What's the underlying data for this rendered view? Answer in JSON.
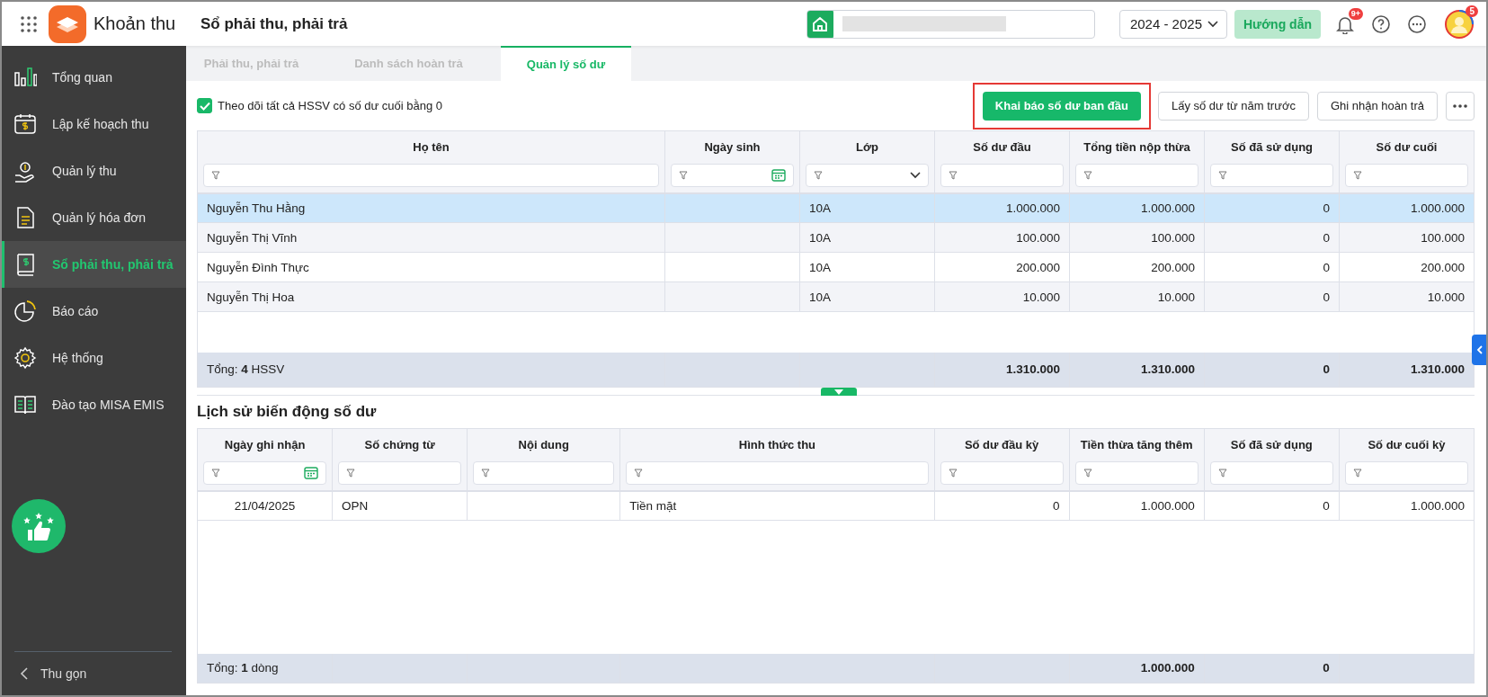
{
  "app": {
    "title": "Khoản thu",
    "page_title": "Sổ phải thu, phải trả"
  },
  "topbar": {
    "year": "2024 - 2025",
    "guide_button": "Hướng dẫn",
    "notification_badge": "9+",
    "avatar_badge": "5"
  },
  "sidebar": {
    "items": [
      {
        "label": "Tổng quan",
        "selected": false
      },
      {
        "label": "Lập kế hoạch thu",
        "selected": false
      },
      {
        "label": "Quản lý thu",
        "selected": false
      },
      {
        "label": "Quản lý hóa đơn",
        "selected": false
      },
      {
        "label": "Sổ phải thu, phải trả",
        "selected": true
      },
      {
        "label": "Báo cáo",
        "selected": false
      },
      {
        "label": "Hệ thống",
        "selected": false
      },
      {
        "label": "Đào tạo MISA EMIS",
        "selected": false
      }
    ],
    "collapse_label": "Thu gọn"
  },
  "tabs": [
    {
      "label": "Phải thu, phải trả",
      "selected": false
    },
    {
      "label": "Danh sách hoàn trả",
      "selected": false
    },
    {
      "label": "Quản lý số dư",
      "selected": true
    }
  ],
  "toolbar": {
    "checkbox": {
      "label": "Theo dõi tất cả HSSV có số dư cuối bằng 0",
      "checked": true
    },
    "buttons": [
      {
        "label": "Khai báo số dư ban đầu",
        "kind": "primary",
        "highlighted": true
      },
      {
        "label": "Lấy số dư từ năm trước",
        "kind": "outline",
        "highlighted": false
      },
      {
        "label": "Ghi nhận hoàn trả",
        "kind": "outline",
        "highlighted": false
      },
      {
        "kind": "more",
        "highlighted": false
      }
    ]
  },
  "balance_table": {
    "columns": [
      {
        "label": "Họ tên",
        "kind": "text"
      },
      {
        "label": "Ngày sinh",
        "kind": "date"
      },
      {
        "label": "Lớp",
        "kind": "select"
      },
      {
        "label": "Số dư đầu",
        "kind": "text",
        "total": "1.310.000"
      },
      {
        "label": "Tổng tiền nộp thừa",
        "kind": "text",
        "total": "1.310.000"
      },
      {
        "label": "Số đã sử dụng",
        "kind": "text",
        "total": "0"
      },
      {
        "label": "Số dư cuối",
        "kind": "text",
        "total": "1.310.000"
      }
    ],
    "rows": [
      {
        "selected": true,
        "full_name": "Nguyễn Thu Hằng",
        "class": "10A",
        "opening_balance": "1.000.000",
        "overpaid_total": "1.000.000",
        "used_amount": "0",
        "closing_balance": "1.000.000"
      },
      {
        "selected": false,
        "full_name": "Nguyễn Thị Vĩnh",
        "class": "10A",
        "opening_balance": "100.000",
        "overpaid_total": "100.000",
        "used_amount": "0",
        "closing_balance": "100.000"
      },
      {
        "selected": false,
        "full_name": "Nguyễn Đình Thực",
        "class": "10A",
        "opening_balance": "200.000",
        "overpaid_total": "200.000",
        "used_amount": "0",
        "closing_balance": "200.000"
      },
      {
        "selected": false,
        "full_name": "Nguyễn Thị Hoa",
        "class": "10A",
        "opening_balance": "10.000",
        "overpaid_total": "10.000",
        "used_amount": "0",
        "closing_balance": "10.000"
      }
    ],
    "footer_label": "Tổng: **4** HSSV"
  },
  "history": {
    "title": "Lịch sử biến động số dư",
    "table": {
      "columns": [
        {
          "label": "Ngày ghi nhận",
          "kind": "date"
        },
        {
          "label": "Số chứng từ",
          "kind": "text"
        },
        {
          "label": "Nội dung",
          "kind": "text"
        },
        {
          "label": "Hình thức thu",
          "kind": "text"
        },
        {
          "label": "Số dư đầu kỳ",
          "kind": "text"
        },
        {
          "label": "Tiền thừa tăng thêm",
          "kind": "text",
          "total": "1.000.000"
        },
        {
          "label": "Số đã sử dụng",
          "kind": "text",
          "total": "0"
        },
        {
          "label": "Số dư cuối kỳ",
          "kind": "text"
        }
      ],
      "rows": [
        {
          "selected": false,
          "recorded_date": "21/04/2025",
          "voucher_no": "OPN",
          "payment_method": "Tiền mặt",
          "opening_balance": "0",
          "overpaid_added": "1.000.000",
          "used_amount": "0",
          "closing_balance": "1.000.000"
        }
      ],
      "footer_label": "Tổng: **1** dòng"
    }
  }
}
